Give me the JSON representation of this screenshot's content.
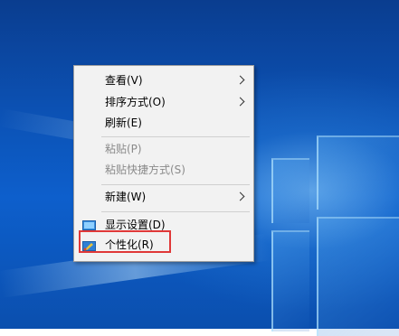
{
  "context_menu": {
    "items": [
      {
        "label": "查看(V)",
        "submenu": true,
        "disabled": false
      },
      {
        "label": "排序方式(O)",
        "submenu": true,
        "disabled": false
      },
      {
        "label": "刷新(E)",
        "submenu": false,
        "disabled": false
      },
      {
        "label": "粘贴(P)",
        "submenu": false,
        "disabled": true
      },
      {
        "label": "粘贴快捷方式(S)",
        "submenu": false,
        "disabled": true
      },
      {
        "label": "新建(W)",
        "submenu": true,
        "disabled": false
      },
      {
        "label": "显示设置(D)",
        "submenu": false,
        "disabled": false,
        "icon": "display-settings-icon"
      },
      {
        "label": "个性化(R)",
        "submenu": false,
        "disabled": false,
        "icon": "personalize-icon"
      }
    ]
  },
  "annotation": {
    "highlighted_item": "个性化(R)",
    "color": "#e03838"
  },
  "wallpaper": {
    "accent": "#0d5fcc"
  }
}
